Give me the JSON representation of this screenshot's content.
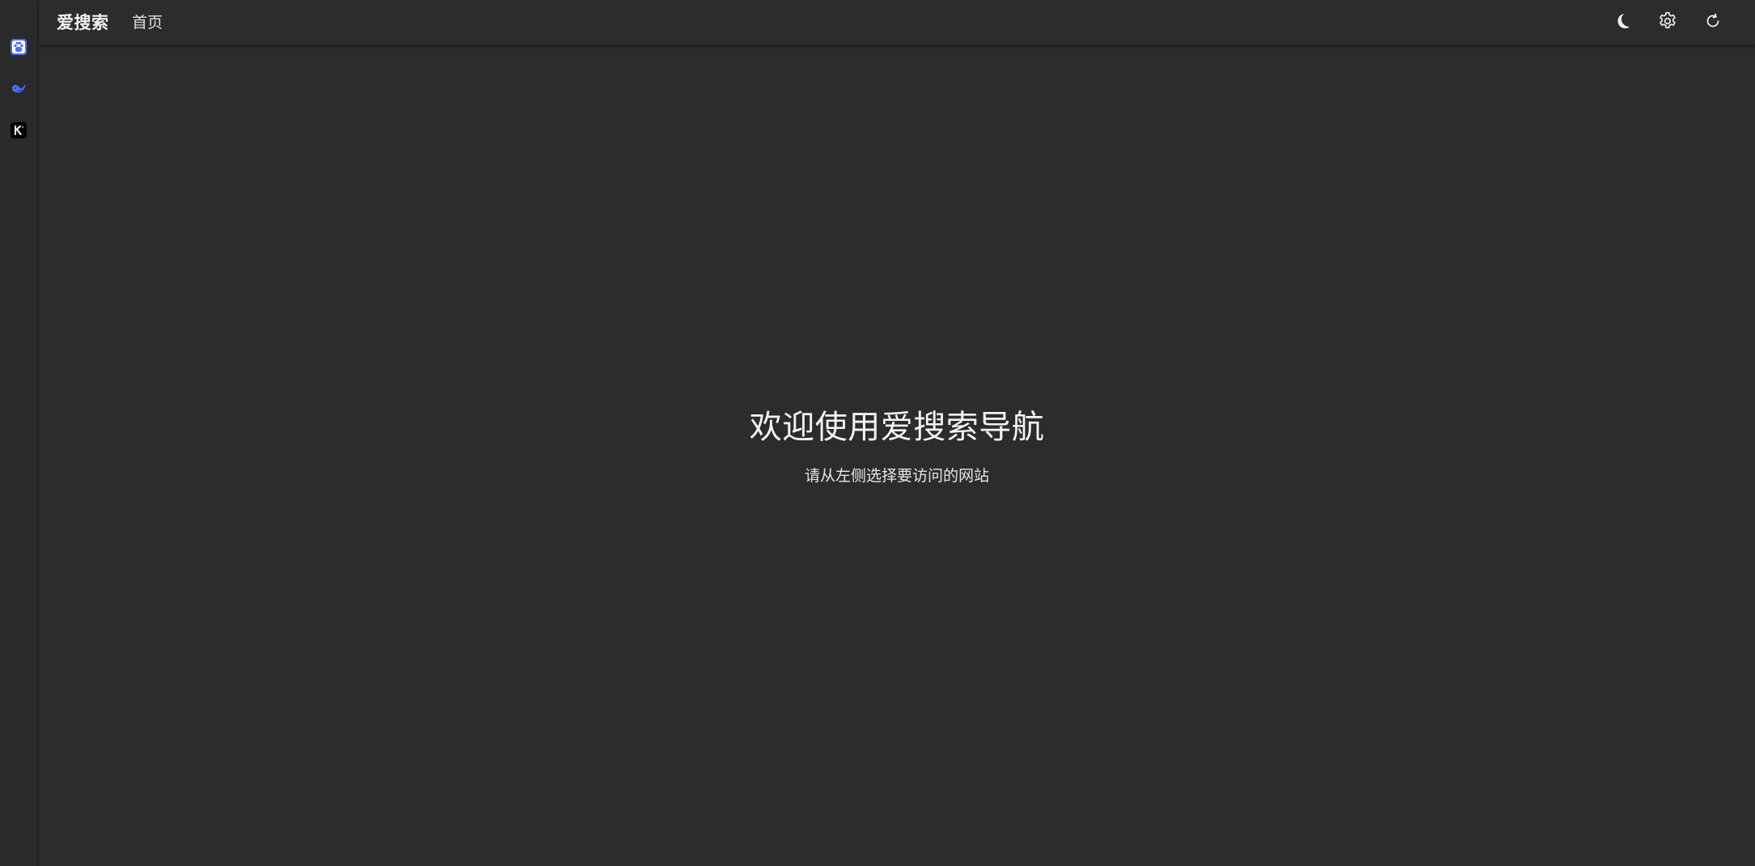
{
  "header": {
    "brand": "爱搜索",
    "nav_home": "首页"
  },
  "sidebar": {
    "items": [
      {
        "icon": "baidu-paw-icon",
        "accent": "#4e6ef2"
      },
      {
        "icon": "deepseek-whale-icon",
        "accent": "#4d6bfe"
      },
      {
        "icon": "kimi-k-icon",
        "accent": "#000000"
      }
    ]
  },
  "toolbar": {
    "theme_icon": "moon-icon",
    "settings_icon": "gear-icon",
    "refresh_icon": "refresh-icon"
  },
  "welcome": {
    "title": "欢迎使用爱搜索导航",
    "subtitle": "请从左侧选择要访问的网站"
  },
  "colors": {
    "background": "#2c2c2c",
    "text": "#f4f4f4"
  }
}
